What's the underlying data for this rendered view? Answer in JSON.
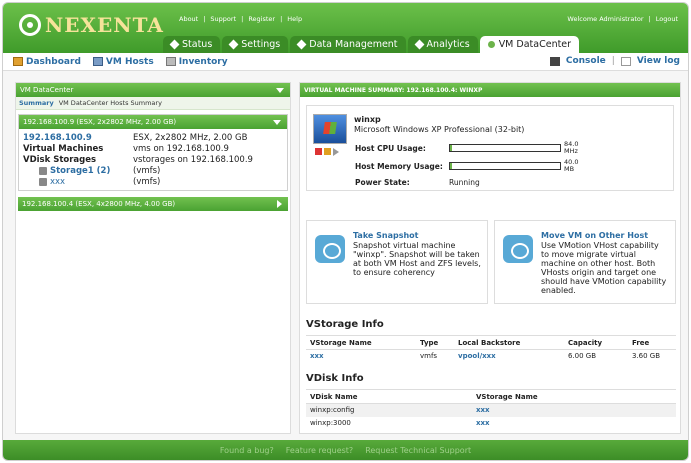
{
  "header": {
    "logo_text": "NEXENTA",
    "top_links": [
      "About",
      "|",
      "Support",
      "|",
      "Register",
      "|",
      "Help"
    ],
    "welcome": "Welcome Administrator",
    "logout": "Logout",
    "tabs": [
      {
        "label": "Status"
      },
      {
        "label": "Settings"
      },
      {
        "label": "Data Management"
      },
      {
        "label": "Analytics"
      },
      {
        "label": "VM DataCenter"
      }
    ]
  },
  "subnav": {
    "dashboard": "Dashboard",
    "vm_hosts": "VM Hosts",
    "inventory": "Inventory",
    "console": "Console",
    "view_log": "View log"
  },
  "left": {
    "title": "VM DataCenter",
    "crumb_summary": "Summary",
    "crumb_hosts": "VM DataCenter Hosts Summary",
    "host1_bar": "192.168.100.9 (ESX, 2x2802 MHz, 2.00 GB)",
    "host1": {
      "ip": "192.168.100.9",
      "ip_value": "ESX, 2x2802 MHz, 2.00 GB",
      "vm_label": "Virtual Machines",
      "vm_value": "vms on 192.168.100.9",
      "vdisk_label": "VDisk Storages",
      "vdisk_value": "vstorages on 192.168.100.9",
      "storage1": "Storage1 (2)",
      "storage1_type": "(vmfs)",
      "storage2": "xxx",
      "storage2_type": "(vmfs)"
    },
    "host2_bar": "192.168.100.4 (ESX, 4x2800 MHz, 4.00 GB)"
  },
  "right": {
    "title": "VIRTUAL MACHINE SUMMARY: 192.168.100.4: WINXP",
    "vm_name": "winxp",
    "vm_os": "Microsoft Windows XP Professional (32-bit)",
    "cpu_label": "Host CPU Usage:",
    "cpu_value": "84.0",
    "cpu_unit": "MHz",
    "mem_label": "Host Memory Usage:",
    "mem_value": "40.0",
    "mem_unit": "MB",
    "power_label": "Power State:",
    "power_value": "Running",
    "snapshot_title": "Take Snapshot",
    "snapshot_desc": "Snapshot virtual machine \"winxp\". Snapshot will be taken at both VM Host and ZFS levels, to ensure coherency",
    "move_title": "Move VM on Other Host",
    "move_desc": "Use VMotion VHost capability to move migrate virtual machine on other host. Both VHosts origin and target one should have VMotion capability enabled.",
    "vstorage_title": "VStorage Info",
    "vstorage_headers": [
      "VStorage Name",
      "Type",
      "Local Backstore",
      "Capacity",
      "Free"
    ],
    "vstorage_rows": [
      [
        "xxx",
        "vmfs",
        "vpool/xxx",
        "6.00 GB",
        "3.60 GB"
      ]
    ],
    "vdisk_title": "VDisk Info",
    "vdisk_headers": [
      "VDisk Name",
      "VStorage Name"
    ],
    "vdisk_rows": [
      [
        "winxp:config",
        "xxx"
      ],
      [
        "winxp:3000",
        "xxx"
      ]
    ]
  },
  "footer": {
    "bug": "Found a bug?",
    "feature": "Feature request?",
    "support": "Request Technical Support"
  },
  "colors": {
    "brand_green": "#4aa232",
    "link_blue": "#2d6ea3",
    "logo_yellow": "#f6e39a"
  }
}
